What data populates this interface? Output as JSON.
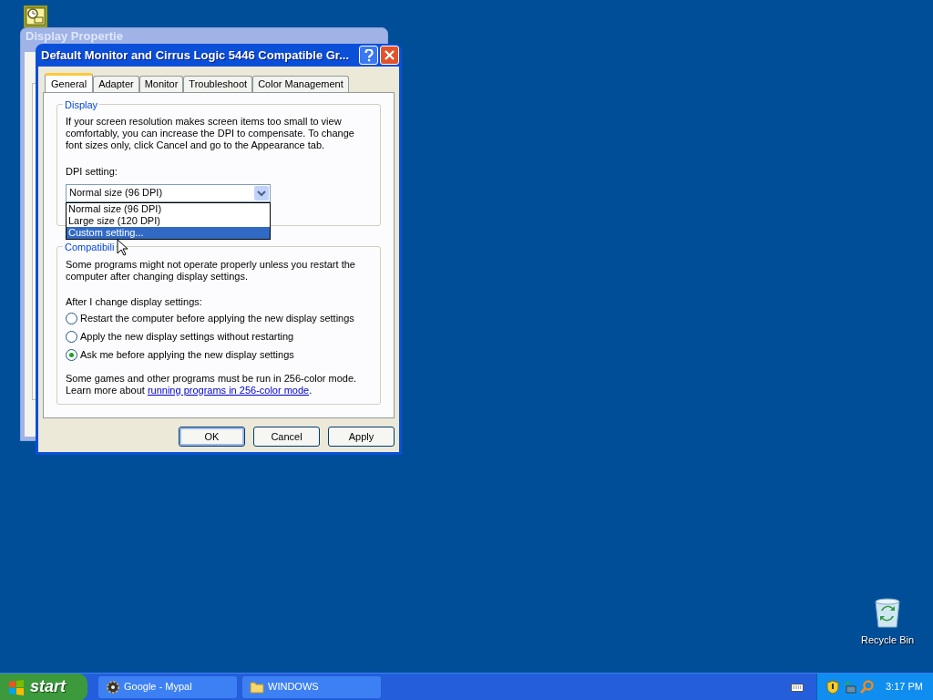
{
  "desktop_icons": [
    {
      "label": "Recycle Bin"
    }
  ],
  "back_window": {
    "title": "Display Propertie"
  },
  "dialog": {
    "title": "Default Monitor and Cirrus Logic 5446 Compatible Gr...",
    "tabs": [
      {
        "label": "General",
        "selected": true
      },
      {
        "label": "Adapter",
        "selected": false
      },
      {
        "label": "Monitor",
        "selected": false
      },
      {
        "label": "Troubleshoot",
        "selected": false
      },
      {
        "label": "Color Management",
        "selected": false
      }
    ],
    "display_group": {
      "legend": "Display",
      "description": "If your screen resolution makes screen items too small to view comfortably, you can increase the DPI to compensate.  To change font sizes only, click Cancel and go to the Appearance tab.",
      "dpi_label": "DPI setting:",
      "dpi_value": "Normal size (96 DPI)",
      "dpi_options": [
        {
          "label": "Normal size (96 DPI)",
          "selected": false
        },
        {
          "label": "Large size (120 DPI)",
          "selected": false
        },
        {
          "label": "Custom setting...",
          "selected": true
        }
      ]
    },
    "compat_group": {
      "legend": "Compatibili",
      "description": "Some programs might not operate properly unless you restart the computer after changing display settings.",
      "after_label": "After I change display settings:",
      "radios": [
        {
          "label": "Restart the computer before applying the new display settings",
          "selected": false
        },
        {
          "label": "Apply the new display settings without restarting",
          "selected": false
        },
        {
          "label": "Ask me before applying the new display settings",
          "selected": true
        }
      ],
      "note": "Some games and other programs must be run in 256-color mode.",
      "note_prefix": "Learn more about ",
      "link": "running programs in 256-color mode",
      "note_suffix": "."
    },
    "buttons": [
      {
        "label": "OK",
        "default": true
      },
      {
        "label": "Cancel",
        "default": false
      },
      {
        "label": "Apply",
        "default": false
      }
    ]
  },
  "taskbar": {
    "start": "start",
    "tasks": [
      {
        "label": "Google - Mypal",
        "kind": "browser"
      },
      {
        "label": "WINDOWS",
        "kind": "folder"
      }
    ],
    "clock": "3:17 PM"
  }
}
